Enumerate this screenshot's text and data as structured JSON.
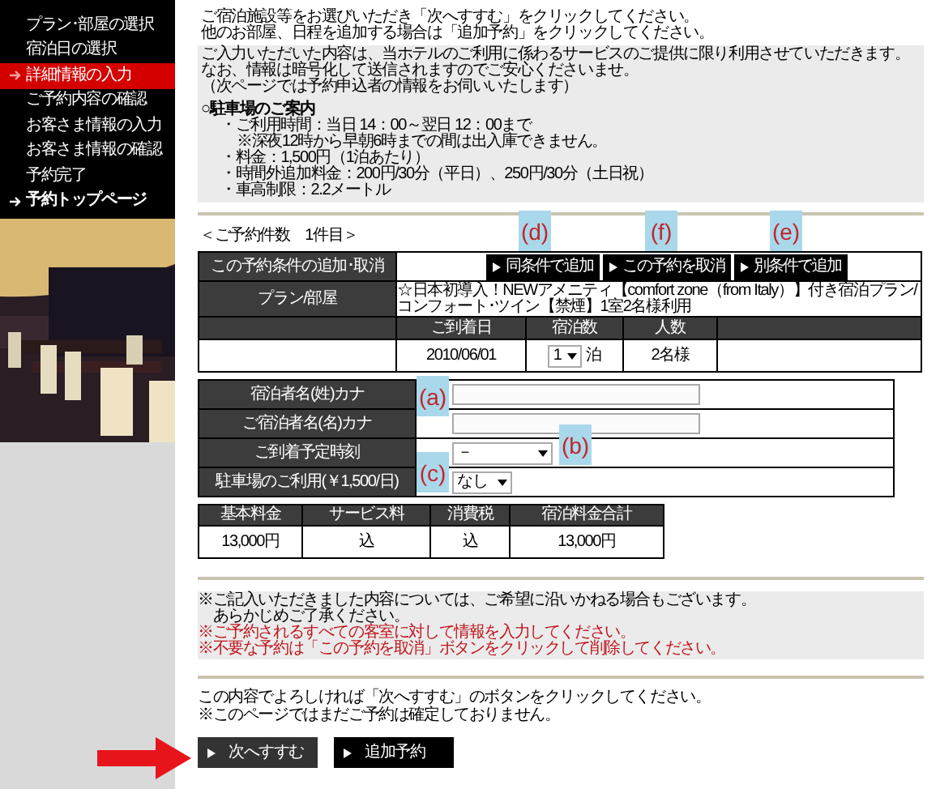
{
  "sidebar": {
    "items": [
      {
        "label": "プラン･部屋の選択",
        "selected": false,
        "kind": "step"
      },
      {
        "label": "宿泊日の選択",
        "selected": false,
        "kind": "step"
      },
      {
        "label": "詳細情報の入力",
        "selected": true,
        "kind": "step"
      },
      {
        "label": "ご予約内容の確認",
        "selected": false,
        "kind": "step"
      },
      {
        "label": "お客さま情報の入力",
        "selected": false,
        "kind": "step"
      },
      {
        "label": "お客さま情報の確認",
        "selected": false,
        "kind": "step"
      },
      {
        "label": "予約完了",
        "selected": false,
        "kind": "step"
      },
      {
        "label": "予約トップページ",
        "selected": false,
        "kind": "top"
      }
    ]
  },
  "intro": [
    "ご宿泊施設等をお選びいただき「次へすすむ」をクリックしてください。",
    "他のお部屋、日程を追加する場合は「追加予約」をクリックしてください。"
  ],
  "notice": {
    "lines": [
      "ご入力いただいた内容は、当ホテルのご利用に係わるサービスのご提供に限り利用させていただきます。",
      "なお、情報は暗号化して送信されますのでご安心くださいませ。",
      "（次ページでは予約申込者の情報をお伺いいたします）"
    ],
    "parking_title": "○駐車場のご案内",
    "parking_lines": [
      {
        "text": "・ご利用時間：当日 14：00～翌日 12：00まで",
        "sub": false
      },
      {
        "text": "※深夜12時から早朝6時までの間は出入庫できません。",
        "sub": true
      },
      {
        "text": "・料金：1,500円（1泊あたり）",
        "sub": false
      },
      {
        "text": "・時間外追加料金：200円/30分（平日）、250円/30分（土日祝）",
        "sub": false
      },
      {
        "text": "・車高制限：2.2メートル",
        "sub": false
      }
    ]
  },
  "booking": {
    "count_label": "＜ご予約件数　1件目＞",
    "action_header": "この予約条件の追加･取消",
    "actions": [
      "同条件で追加",
      "この予約を取消",
      "別条件で追加"
    ],
    "plan_header": "プラン/部屋",
    "plan": "☆日本初導入！NEWアメニティ【comfort zone（from Italy）】付き宿泊プラン/コンフォート･ツイン【禁煙】1室2名様利用",
    "columns": [
      "ご到着日",
      "宿泊数",
      "人数"
    ],
    "arrival": "2010/06/01",
    "nights": "1",
    "nights_unit": "泊",
    "guests": "2名様"
  },
  "form": [
    {
      "label": "宿泊者名(姓)カナ",
      "kind": "text"
    },
    {
      "label": "ご宿泊者名(名)カナ",
      "kind": "text"
    },
    {
      "label": "ご到着予定時刻",
      "kind": "select",
      "value": "－"
    },
    {
      "label": "駐車場のご利用(￥1,500/日)",
      "kind": "select",
      "value": "なし"
    }
  ],
  "price": {
    "columns": [
      "基本料金",
      "サービス料",
      "消費税",
      "宿泊料金合計"
    ],
    "values": [
      "13,000円",
      "込",
      "込",
      "13,000円"
    ]
  },
  "notes": [
    {
      "text": "※ご記入いただきました内容については、ご希望に沿いかねる場合もございます。",
      "warning": false
    },
    {
      "text": "　あらかじめご了承ください。",
      "warning": false
    },
    {
      "text": "※ご予約されるすべての客室に対して情報を入力してください。",
      "warning": true
    },
    {
      "text": "※不要な予約は「この予約を取消」ボタンをクリックして削除してください。",
      "warning": true
    }
  ],
  "confirm": [
    "この内容でよろしければ「次へすすむ」のボタンをクリックしてください。",
    "※このページではまだご予約は確定しておりません。"
  ],
  "buttons": [
    "次へすすむ",
    "追加予約"
  ],
  "annotations": [
    "(d)",
    "(f)",
    "(e)",
    "(a)",
    "(b)",
    "(c)"
  ]
}
